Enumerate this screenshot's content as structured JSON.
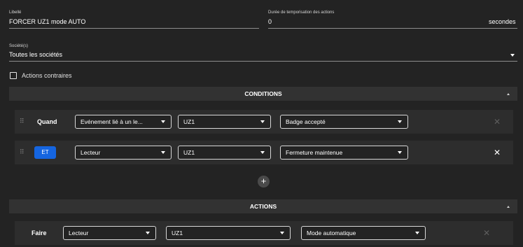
{
  "libelle": {
    "label": "Libellé",
    "value": "FORCER UZ1 mode AUTO"
  },
  "duree": {
    "label": "Durée de temporisation des actions",
    "value": "0",
    "suffix": "secondes"
  },
  "societes": {
    "label": "Société(s)",
    "value": "Toutes les sociétés"
  },
  "actions_contraires": {
    "label": "Actions contraires",
    "checked": false
  },
  "conditions": {
    "title": "CONDITIONS",
    "rows": [
      {
        "keyword": "Quand",
        "select1": "Evénement lié à un le...",
        "select2": "UZ1",
        "select3": "Badge accepté"
      },
      {
        "keyword": "ET",
        "select1": "Lecteur",
        "select2": "UZ1",
        "select3": "Fermeture maintenue"
      }
    ],
    "add_label": "+"
  },
  "actions": {
    "title": "ACTIONS",
    "rows": [
      {
        "keyword": "Faire",
        "select1": "Lecteur",
        "select2": "UZ1",
        "select3": "Mode automatique"
      }
    ]
  },
  "colors": {
    "background": "#232323",
    "accent": "#1565e0",
    "section_bar": "#323232"
  }
}
